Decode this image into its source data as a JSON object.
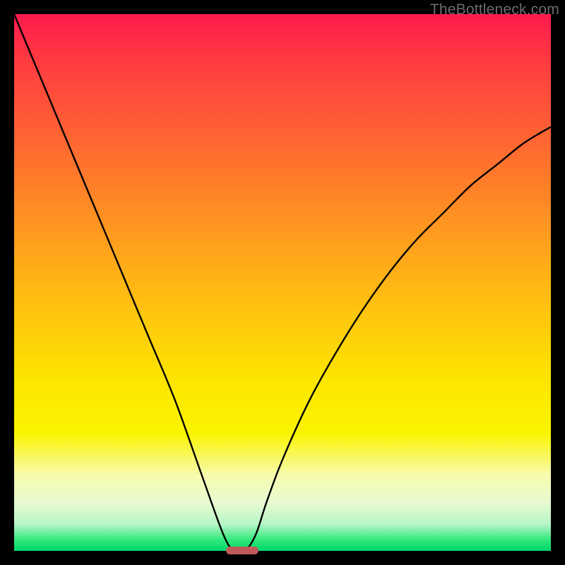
{
  "watermark": "TheBottleneck.com",
  "chart_data": {
    "type": "line",
    "title": "",
    "xlabel": "",
    "ylabel": "",
    "xlim": [
      0,
      1
    ],
    "ylim": [
      0,
      1
    ],
    "series": [
      {
        "name": "bottleneck-curve",
        "x": [
          0.0,
          0.05,
          0.1,
          0.15,
          0.2,
          0.25,
          0.3,
          0.35,
          0.39,
          0.41,
          0.43,
          0.45,
          0.47,
          0.5,
          0.55,
          0.6,
          0.65,
          0.7,
          0.75,
          0.8,
          0.85,
          0.9,
          0.95,
          1.0
        ],
        "y": [
          1.0,
          0.88,
          0.76,
          0.64,
          0.52,
          0.4,
          0.28,
          0.14,
          0.03,
          0.0,
          0.0,
          0.03,
          0.09,
          0.17,
          0.28,
          0.37,
          0.45,
          0.52,
          0.58,
          0.63,
          0.68,
          0.72,
          0.76,
          0.79
        ]
      }
    ],
    "optimum_marker": {
      "x_start": 0.395,
      "x_end": 0.455,
      "y": 0.0
    },
    "gradient": [
      {
        "stop": 0.0,
        "color": "#ff1a4d"
      },
      {
        "stop": 0.5,
        "color": "#ffc310"
      },
      {
        "stop": 0.78,
        "color": "#fbf400"
      },
      {
        "stop": 1.0,
        "color": "#00d46a"
      }
    ]
  }
}
